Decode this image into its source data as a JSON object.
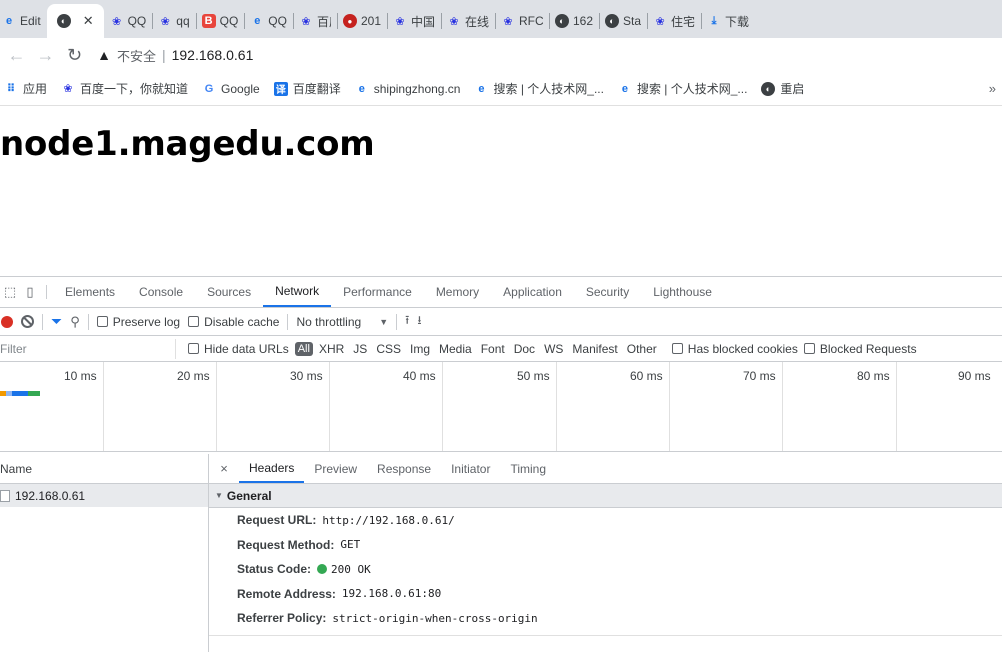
{
  "browser": {
    "tabs": [
      {
        "title": "Edit",
        "icon": "edge-icon",
        "color": "#1a73e8"
      },
      {
        "title": "",
        "icon": "globe-icon",
        "color": "#3c4043",
        "active": true
      },
      {
        "title": "QQ",
        "icon": "baidu-paw-icon",
        "color": "#2932e1"
      },
      {
        "title": "qq",
        "icon": "baidu-paw-icon",
        "color": "#2932e1"
      },
      {
        "title": "QQ",
        "icon": "b-logo-icon",
        "color": "#e8453c"
      },
      {
        "title": "QQ",
        "icon": "edge-icon",
        "color": "#1a73e8"
      },
      {
        "title": "百度",
        "icon": "baidu-paw-icon",
        "color": "#2932e1"
      },
      {
        "title": "201",
        "icon": "chrome-red-icon",
        "color": "#c5221f"
      },
      {
        "title": "中国",
        "icon": "baidu-paw-icon",
        "color": "#2932e1"
      },
      {
        "title": "在线",
        "icon": "baidu-paw-icon",
        "color": "#2932e1"
      },
      {
        "title": "RFC",
        "icon": "baidu-paw-icon",
        "color": "#2932e1"
      },
      {
        "title": "162",
        "icon": "globe-icon",
        "color": "#3c4043"
      },
      {
        "title": "Sta",
        "icon": "globe-icon",
        "color": "#3c4043"
      },
      {
        "title": "住宅",
        "icon": "baidu-paw-icon",
        "color": "#2932e1"
      },
      {
        "title": "下载",
        "icon": "download-icon",
        "color": "#1a73e8"
      }
    ],
    "address": {
      "security_label": "不安全",
      "url": "192.168.0.61"
    },
    "bookmarks": [
      {
        "label": "应用",
        "icon": "apps-grid-icon"
      },
      {
        "label": "百度一下，你就知道",
        "icon": "baidu-paw-icon"
      },
      {
        "label": "Google",
        "icon": "google-icon"
      },
      {
        "label": "百度翻译",
        "icon": "translate-icon"
      },
      {
        "label": "shipingzhong.cn",
        "icon": "edge-icon"
      },
      {
        "label": "搜索 | 个人技术网_...",
        "icon": "edge-icon"
      },
      {
        "label": "搜索 | 个人技术网_...",
        "icon": "edge-icon"
      },
      {
        "label": "重启",
        "icon": "globe-icon"
      }
    ],
    "bookmarks_more": "»"
  },
  "page": {
    "heading": "node1.magedu.com"
  },
  "devtools": {
    "tabs": [
      "Elements",
      "Console",
      "Sources",
      "Network",
      "Performance",
      "Memory",
      "Application",
      "Security",
      "Lighthouse"
    ],
    "active_tab": "Network",
    "toolbar": {
      "preserve_log": "Preserve log",
      "disable_cache": "Disable cache",
      "throttling": "No throttling"
    },
    "filter": {
      "placeholder": "Filter",
      "hide_data_urls": "Hide data URLs",
      "all": "All",
      "types": [
        "XHR",
        "JS",
        "CSS",
        "Img",
        "Media",
        "Font",
        "Doc",
        "WS",
        "Manifest",
        "Other"
      ],
      "has_blocked_cookies": "Has blocked cookies",
      "blocked_requests": "Blocked Requests"
    },
    "timeline_ticks": [
      "10 ms",
      "20 ms",
      "30 ms",
      "40 ms",
      "50 ms",
      "60 ms",
      "70 ms",
      "80 ms",
      "90 ms"
    ],
    "requests": {
      "column": "Name",
      "rows": [
        "192.168.0.61"
      ]
    },
    "details": {
      "close": "×",
      "tabs": [
        "Headers",
        "Preview",
        "Response",
        "Initiator",
        "Timing"
      ],
      "active_tab": "Headers",
      "section": "General",
      "fields": [
        {
          "key": "Request URL:",
          "value": "http://192.168.0.61/"
        },
        {
          "key": "Request Method:",
          "value": "GET"
        },
        {
          "key": "Status Code:",
          "value": "200 OK",
          "status_color": "#34a853"
        },
        {
          "key": "Remote Address:",
          "value": "192.168.0.61:80"
        },
        {
          "key": "Referrer Policy:",
          "value": "strict-origin-when-cross-origin"
        }
      ]
    }
  }
}
